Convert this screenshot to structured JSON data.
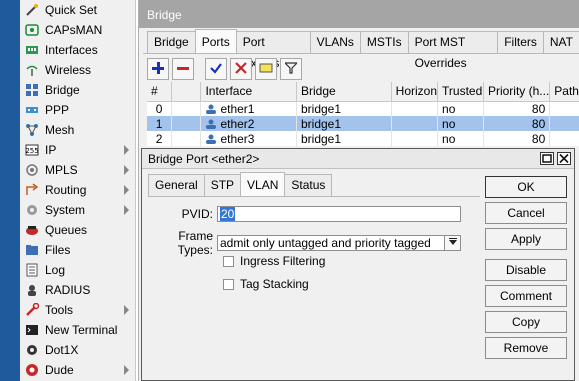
{
  "sidebar": {
    "items": [
      {
        "label": "Quick Set",
        "icon": "wand-icon",
        "arrow": false
      },
      {
        "label": "CAPsMAN",
        "icon": "capsman-icon",
        "arrow": false
      },
      {
        "label": "Interfaces",
        "icon": "interfaces-icon",
        "arrow": false
      },
      {
        "label": "Wireless",
        "icon": "wireless-icon",
        "arrow": false
      },
      {
        "label": "Bridge",
        "icon": "bridge-icon",
        "arrow": false
      },
      {
        "label": "PPP",
        "icon": "ppp-icon",
        "arrow": false
      },
      {
        "label": "Mesh",
        "icon": "mesh-icon",
        "arrow": false
      },
      {
        "label": "IP",
        "icon": "ip-icon",
        "arrow": true
      },
      {
        "label": "MPLS",
        "icon": "mpls-icon",
        "arrow": true
      },
      {
        "label": "Routing",
        "icon": "routing-icon",
        "arrow": true
      },
      {
        "label": "System",
        "icon": "gear-icon",
        "arrow": true
      },
      {
        "label": "Queues",
        "icon": "queues-icon",
        "arrow": false
      },
      {
        "label": "Files",
        "icon": "folder-icon",
        "arrow": false
      },
      {
        "label": "Log",
        "icon": "log-icon",
        "arrow": false
      },
      {
        "label": "RADIUS",
        "icon": "radius-icon",
        "arrow": false
      },
      {
        "label": "Tools",
        "icon": "tools-icon",
        "arrow": true
      },
      {
        "label": "New Terminal",
        "icon": "terminal-icon",
        "arrow": false
      },
      {
        "label": "Dot1X",
        "icon": "dot1x-icon",
        "arrow": false
      },
      {
        "label": "Dude",
        "icon": "dude-icon",
        "arrow": true
      }
    ]
  },
  "bridge_window": {
    "title": "Bridge",
    "tabs": [
      "Bridge",
      "Ports",
      "Port Extensions",
      "VLANs",
      "MSTIs",
      "Port MST Overrides",
      "Filters",
      "NAT"
    ],
    "active_tab": "Ports"
  },
  "ports_table": {
    "columns": [
      "#",
      "",
      "Interface",
      "Bridge",
      "Horizon",
      "Trusted",
      "Priority (h...",
      "Path"
    ],
    "rows": [
      {
        "num": "0",
        "interface": "ether1",
        "bridge": "bridge1",
        "horizon": "",
        "trusted": "no",
        "priority": "80",
        "path": ""
      },
      {
        "num": "1",
        "interface": "ether2",
        "bridge": "bridge1",
        "horizon": "",
        "trusted": "no",
        "priority": "80",
        "path": ""
      },
      {
        "num": "2",
        "interface": "ether3",
        "bridge": "bridge1",
        "horizon": "",
        "trusted": "no",
        "priority": "80",
        "path": ""
      }
    ],
    "selected_row": 1
  },
  "dialog": {
    "title": "Bridge Port <ether2>",
    "tabs": [
      "General",
      "STP",
      "VLAN",
      "Status"
    ],
    "active_tab": "VLAN",
    "pvid_label": "PVID:",
    "pvid_value": "20",
    "frame_types_label": "Frame Types:",
    "frame_types_value": "admit only untagged and priority tagged",
    "ingress_filtering_label": "Ingress Filtering",
    "tag_stacking_label": "Tag Stacking",
    "buttons": [
      "OK",
      "Cancel",
      "Apply",
      "Disable",
      "Comment",
      "Copy",
      "Remove"
    ]
  },
  "colors": {
    "sidebar_strip": "#1e5a9c",
    "selection": "#a4c3ec",
    "titlebar_gray": "#a5a5a5"
  }
}
